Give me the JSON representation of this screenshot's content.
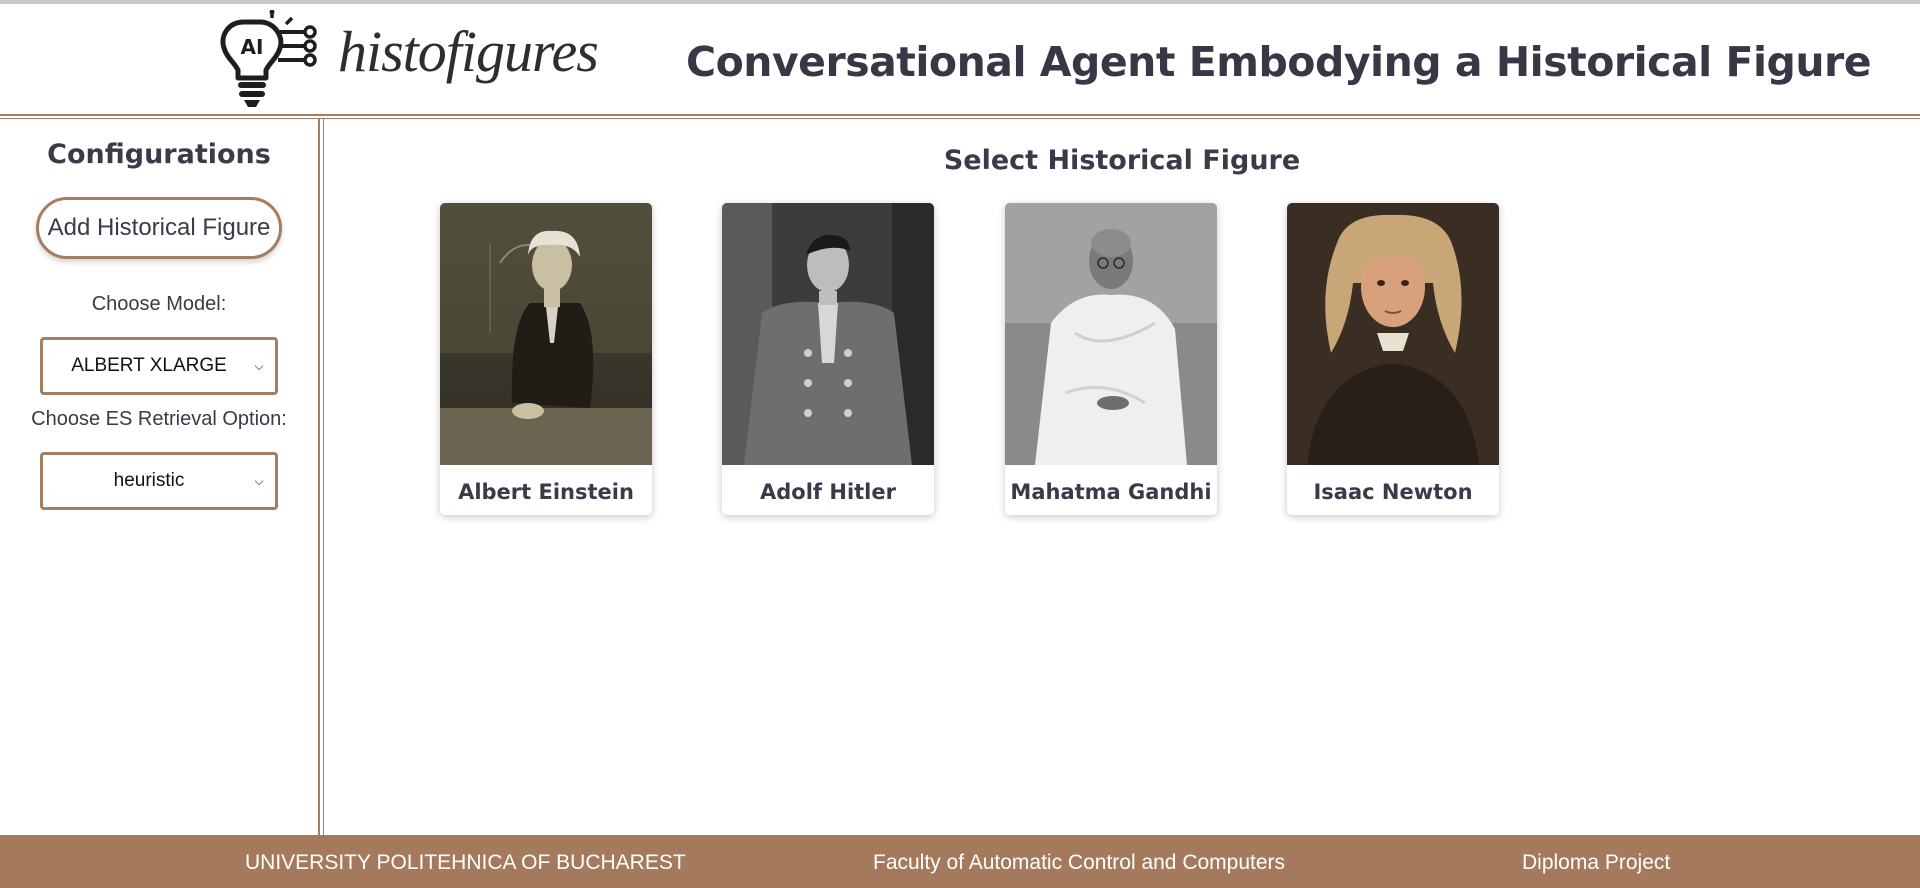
{
  "header": {
    "logo_badge": "AI",
    "logo_text": "histofigures",
    "title": "Conversational Agent Embodying a Historical Figure"
  },
  "sidebar": {
    "title": "Configurations",
    "add_button_label": "Add Historical Figure",
    "model_label": "Choose Model:",
    "model_selected": "ALBERT XLARGE",
    "retrieval_label": "Choose ES Retrieval Option:",
    "retrieval_selected": "heuristic"
  },
  "main": {
    "title": "Select Historical Figure",
    "figures": [
      {
        "name": "Albert Einstein"
      },
      {
        "name": "Adolf Hitler"
      },
      {
        "name": "Mahatma Gandhi"
      },
      {
        "name": "Isaac Newton"
      }
    ]
  },
  "footer": {
    "university": "UNIVERSITY POLITEHNICA OF BUCHAREST",
    "faculty": "Faculty of Automatic Control and Computers",
    "project": "Diploma Project"
  },
  "colors": {
    "accent": "#a57e62",
    "footer_bg": "#a57a5c",
    "text": "#3a3a48"
  }
}
